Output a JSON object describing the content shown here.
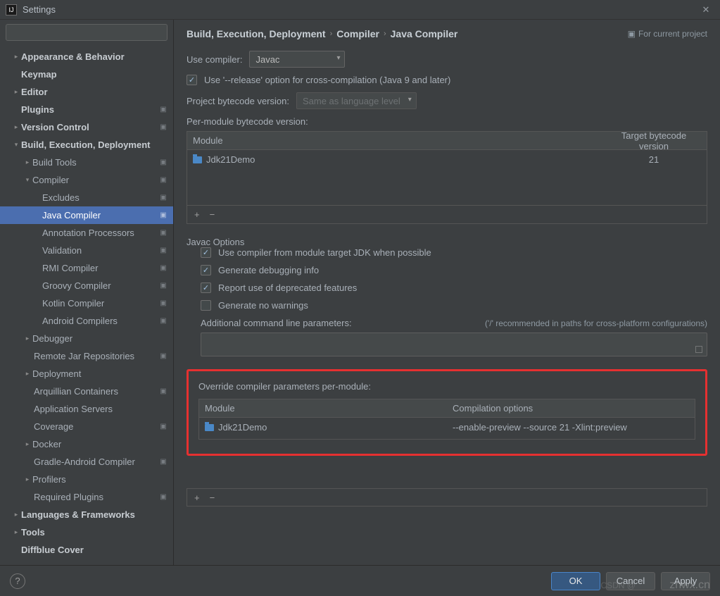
{
  "titlebar": {
    "title": "Settings"
  },
  "search": {
    "placeholder": ""
  },
  "tree": {
    "appearance": "Appearance & Behavior",
    "keymap": "Keymap",
    "editor": "Editor",
    "plugins": "Plugins",
    "vcs": "Version Control",
    "bed": "Build, Execution, Deployment",
    "build_tools": "Build Tools",
    "compiler": "Compiler",
    "excludes": "Excludes",
    "java_compiler": "Java Compiler",
    "ann_proc": "Annotation Processors",
    "validation": "Validation",
    "rmi": "RMI Compiler",
    "groovy": "Groovy Compiler",
    "kotlin": "Kotlin Compiler",
    "android": "Android Compilers",
    "debugger": "Debugger",
    "remote_repos": "Remote Jar Repositories",
    "deployment": "Deployment",
    "arquillian": "Arquillian Containers",
    "app_servers": "Application Servers",
    "coverage": "Coverage",
    "docker": "Docker",
    "gradle_android": "Gradle-Android Compiler",
    "profilers": "Profilers",
    "required_plugins": "Required Plugins",
    "lang_fw": "Languages & Frameworks",
    "tools": "Tools",
    "diffblue": "Diffblue Cover"
  },
  "breadcrumb": {
    "p0": "Build, Execution, Deployment",
    "p1": "Compiler",
    "p2": "Java Compiler",
    "for_project": "For current project"
  },
  "form": {
    "use_compiler_label": "Use compiler:",
    "use_compiler_value": "Javac",
    "opt_release": "Use '--release' option for cross-compilation (Java 9 and later)",
    "project_bytecode_label": "Project bytecode version:",
    "project_bytecode_value": "Same as language level",
    "per_module_label": "Per-module bytecode version:",
    "table1": {
      "col_module": "Module",
      "col_version": "Target bytecode version",
      "rows": [
        {
          "module": "Jdk21Demo",
          "version": "21"
        }
      ]
    },
    "javac_options": "Javac Options",
    "opt_jdk": "Use compiler from module target JDK when possible",
    "opt_debug": "Generate debugging info",
    "opt_deprecated": "Report use of deprecated features",
    "opt_nowarn": "Generate no warnings",
    "additional_label": "Additional command line parameters:",
    "additional_note": "('/' recommended in paths for cross-platform configurations)",
    "override_label": "Override compiler parameters per-module:",
    "table2": {
      "col_module": "Module",
      "col_opts": "Compilation options",
      "rows": [
        {
          "module": "Jdk21Demo",
          "opts": "--enable-preview --source 21 -Xlint:preview"
        }
      ]
    },
    "plus": "+",
    "minus": "−"
  },
  "footer": {
    "ok": "OK",
    "cancel": "Cancel",
    "apply": "Apply"
  },
  "watermark": {
    "w1": "znwx.cn",
    "w2": "CSDN @"
  }
}
